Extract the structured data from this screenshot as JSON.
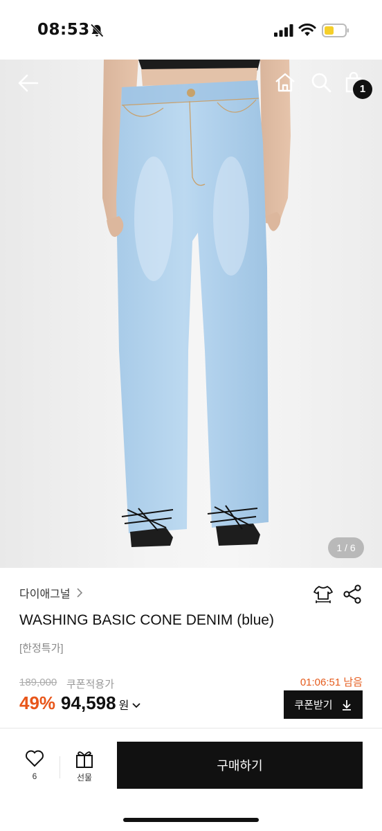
{
  "status_bar": {
    "time": "08:53",
    "icons": [
      "bell-slash-icon",
      "signal-icon",
      "wifi-icon",
      "battery-icon"
    ]
  },
  "hero": {
    "image_counter": "1 / 6",
    "cart_count": "1",
    "icons": [
      "back-arrow-icon",
      "home-icon",
      "search-icon",
      "cart-icon"
    ]
  },
  "product": {
    "brand": "다이애그널",
    "title": "WASHING BASIC CONE DENIM (blue)",
    "tag": "[한정특가]"
  },
  "price": {
    "original": "189,000",
    "coupon_note": "쿠폰적용가",
    "countdown": "01:06:51 남음",
    "discount": "49%",
    "sale": "94,598",
    "currency": "원",
    "coupon_button": "쿠폰받기"
  },
  "bottom_bar": {
    "like_count": "6",
    "gift_label": "선물",
    "buy_label": "구매하기"
  },
  "colors": {
    "accent_orange": "#e8561a",
    "button_black": "#111111"
  }
}
